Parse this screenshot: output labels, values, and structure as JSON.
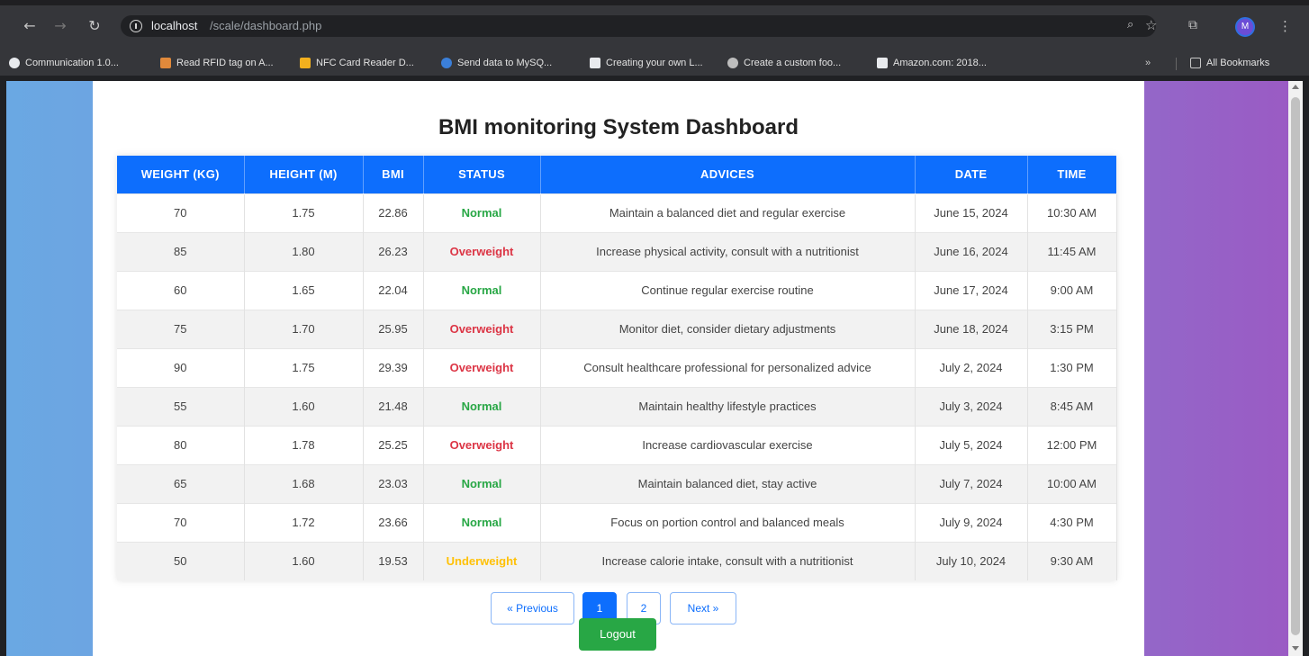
{
  "browser": {
    "url_host": "localhost",
    "url_path": "/scale/dashboard.php",
    "profile_initial": "M",
    "bookmarks": [
      {
        "label": "Communication 1.0...",
        "color": "#e8eaed"
      },
      {
        "label": "Read RFID tag on A...",
        "color": "#e0893b"
      },
      {
        "label": "NFC Card Reader D...",
        "color": "#f2b01e"
      },
      {
        "label": "Send data to MySQ...",
        "color": "#3b7fd9"
      },
      {
        "label": "Creating your own L...",
        "color": "#e8eaed"
      },
      {
        "label": "Create a custom foo...",
        "color": "#bdbdbd"
      },
      {
        "label": "Amazon.com: 2018...",
        "color": "#e8eaed"
      }
    ],
    "all_bookmarks_label": "All Bookmarks"
  },
  "page": {
    "title": "BMI monitoring System Dashboard",
    "logout_label": "Logout"
  },
  "table": {
    "headers": [
      "Weight (kg)",
      "Height (m)",
      "BMI",
      "Status",
      "Advices",
      "Date",
      "Time"
    ],
    "rows": [
      {
        "weight": "70",
        "height": "1.75",
        "bmi": "22.86",
        "status": "Normal",
        "advice": "Maintain a balanced diet and regular exercise",
        "date": "June 15, 2024",
        "time": "10:30 AM"
      },
      {
        "weight": "85",
        "height": "1.80",
        "bmi": "26.23",
        "status": "Overweight",
        "advice": "Increase physical activity, consult with a nutritionist",
        "date": "June 16, 2024",
        "time": "11:45 AM"
      },
      {
        "weight": "60",
        "height": "1.65",
        "bmi": "22.04",
        "status": "Normal",
        "advice": "Continue regular exercise routine",
        "date": "June 17, 2024",
        "time": "9:00 AM"
      },
      {
        "weight": "75",
        "height": "1.70",
        "bmi": "25.95",
        "status": "Overweight",
        "advice": "Monitor diet, consider dietary adjustments",
        "date": "June 18, 2024",
        "time": "3:15 PM"
      },
      {
        "weight": "90",
        "height": "1.75",
        "bmi": "29.39",
        "status": "Overweight",
        "advice": "Consult healthcare professional for personalized advice",
        "date": "July 2, 2024",
        "time": "1:30 PM"
      },
      {
        "weight": "55",
        "height": "1.60",
        "bmi": "21.48",
        "status": "Normal",
        "advice": "Maintain healthy lifestyle practices",
        "date": "July 3, 2024",
        "time": "8:45 AM"
      },
      {
        "weight": "80",
        "height": "1.78",
        "bmi": "25.25",
        "status": "Overweight",
        "advice": "Increase cardiovascular exercise",
        "date": "July 5, 2024",
        "time": "12:00 PM"
      },
      {
        "weight": "65",
        "height": "1.68",
        "bmi": "23.03",
        "status": "Normal",
        "advice": "Maintain balanced diet, stay active",
        "date": "July 7, 2024",
        "time": "10:00 AM"
      },
      {
        "weight": "70",
        "height": "1.72",
        "bmi": "23.66",
        "status": "Normal",
        "advice": "Focus on portion control and balanced meals",
        "date": "July 9, 2024",
        "time": "4:30 PM"
      },
      {
        "weight": "50",
        "height": "1.60",
        "bmi": "19.53",
        "status": "Underweight",
        "advice": "Increase calorie intake, consult with a nutritionist",
        "date": "July 10, 2024",
        "time": "9:30 AM"
      }
    ],
    "status_colors": {
      "Normal": "#28a745",
      "Overweight": "#dc3545",
      "Underweight": "#ffc107"
    }
  },
  "pagination": {
    "previous_label": "« Previous",
    "pages": [
      "1",
      "2"
    ],
    "current": "1",
    "next_label": "Next »"
  }
}
